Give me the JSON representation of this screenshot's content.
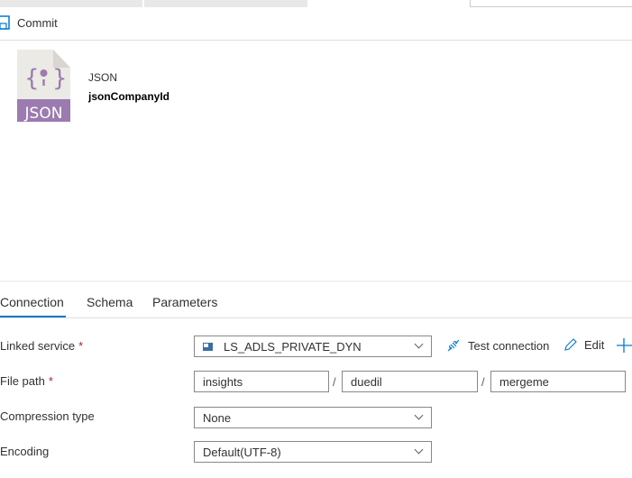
{
  "toolbar": {
    "commit_label": "Commit"
  },
  "dataset": {
    "type": "JSON",
    "name": "jsonCompanyId",
    "icon_text": "JSON",
    "icon": "json-file-icon"
  },
  "tabs": [
    {
      "label": "Connection",
      "active": true
    },
    {
      "label": "Schema"
    },
    {
      "label": "Parameters"
    }
  ],
  "form": {
    "linked_service": {
      "label": "Linked service",
      "required": "*",
      "value": "LS_ADLS_PRIVATE_DYN",
      "test_label": "Test connection",
      "edit_label": "Edit"
    },
    "file_path": {
      "label": "File path",
      "required": "*",
      "container": "insights",
      "directory": "duedil",
      "file": "mergeme",
      "separator": "/"
    },
    "compression": {
      "label": "Compression type",
      "value": "None"
    },
    "encoding": {
      "label": "Encoding",
      "value": "Default(UTF-8)"
    }
  },
  "colors": {
    "accent": "#0078d4",
    "json_purple": "#9b7bb0"
  }
}
